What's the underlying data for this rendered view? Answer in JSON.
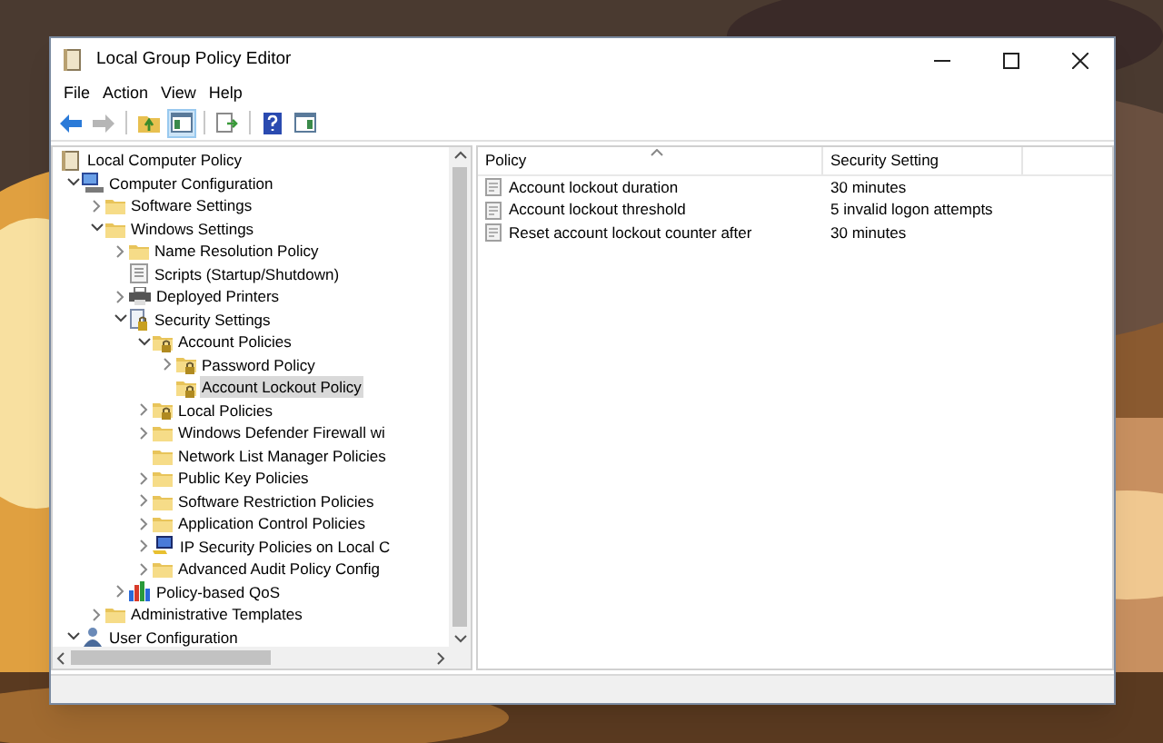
{
  "window": {
    "title": "Local Group Policy Editor"
  },
  "menu": [
    "File",
    "Action",
    "View",
    "Help"
  ],
  "toolbar": [
    {
      "kind": "back",
      "disabled": false,
      "pressed": false
    },
    {
      "kind": "forward",
      "disabled": true,
      "pressed": false
    },
    {
      "kind": "separator"
    },
    {
      "kind": "up",
      "disabled": false,
      "pressed": false
    },
    {
      "kind": "tree-toggle",
      "disabled": false,
      "pressed": true
    },
    {
      "kind": "separator"
    },
    {
      "kind": "export",
      "disabled": false,
      "pressed": false
    },
    {
      "kind": "separator"
    },
    {
      "kind": "help",
      "disabled": false,
      "pressed": false
    },
    {
      "kind": "action-pane",
      "disabled": false,
      "pressed": false
    }
  ],
  "tree": {
    "label": "Local Computer Policy",
    "kind": "book",
    "selected": false,
    "children": [
      {
        "label": "Computer Configuration",
        "kind": "computer",
        "expanded": true,
        "selected": false,
        "children": [
          {
            "label": "Software Settings",
            "kind": "folder",
            "expanded": false,
            "selected": false
          },
          {
            "label": "Windows Settings",
            "kind": "folder",
            "expanded": true,
            "selected": false,
            "children": [
              {
                "label": "Name Resolution Policy",
                "kind": "folder",
                "expanded": false,
                "selected": false
              },
              {
                "label": "Scripts (Startup/Shutdown)",
                "kind": "scripts",
                "selected": false
              },
              {
                "label": "Deployed Printers",
                "kind": "printer",
                "expanded": false,
                "selected": false
              },
              {
                "label": "Security Settings",
                "kind": "security",
                "expanded": true,
                "selected": false,
                "children": [
                  {
                    "label": "Account Policies",
                    "kind": "lock-folder",
                    "expanded": true,
                    "selected": false,
                    "children": [
                      {
                        "label": "Password Policy",
                        "kind": "lock-folder",
                        "expanded": false,
                        "selected": false
                      },
                      {
                        "label": "Account Lockout Policy",
                        "kind": "lock-folder",
                        "selected": true
                      }
                    ]
                  },
                  {
                    "label": "Local Policies",
                    "kind": "lock-folder",
                    "expanded": false,
                    "selected": false
                  },
                  {
                    "label": "Windows Defender Firewall wi",
                    "kind": "folder",
                    "expanded": false,
                    "selected": false
                  },
                  {
                    "label": "Network List Manager Policies",
                    "kind": "folder",
                    "selected": false
                  },
                  {
                    "label": "Public Key Policies",
                    "kind": "folder",
                    "expanded": false,
                    "selected": false
                  },
                  {
                    "label": "Software Restriction Policies",
                    "kind": "folder",
                    "expanded": false,
                    "selected": false
                  },
                  {
                    "label": "Application Control Policies",
                    "kind": "folder",
                    "expanded": false,
                    "selected": false
                  },
                  {
                    "label": "IP Security Policies on Local C",
                    "kind": "ipsec",
                    "expanded": false,
                    "selected": false
                  },
                  {
                    "label": "Advanced Audit Policy Config",
                    "kind": "folder",
                    "expanded": false,
                    "selected": false
                  }
                ]
              },
              {
                "label": "Policy-based QoS",
                "kind": "chart",
                "expanded": false,
                "selected": false
              }
            ]
          },
          {
            "label": "Administrative Templates",
            "kind": "folder",
            "expanded": false,
            "selected": false
          }
        ]
      },
      {
        "label": "User Configuration",
        "kind": "user",
        "expanded": true,
        "selected": false
      }
    ]
  },
  "table": {
    "columns": [
      "Policy",
      "Security Setting"
    ],
    "rows": [
      {
        "policy": "Account lockout duration",
        "setting": "30 minutes"
      },
      {
        "policy": "Account lockout threshold",
        "setting": "5 invalid logon attempts"
      },
      {
        "policy": "Reset account lockout counter after",
        "setting": "30 minutes"
      }
    ]
  }
}
